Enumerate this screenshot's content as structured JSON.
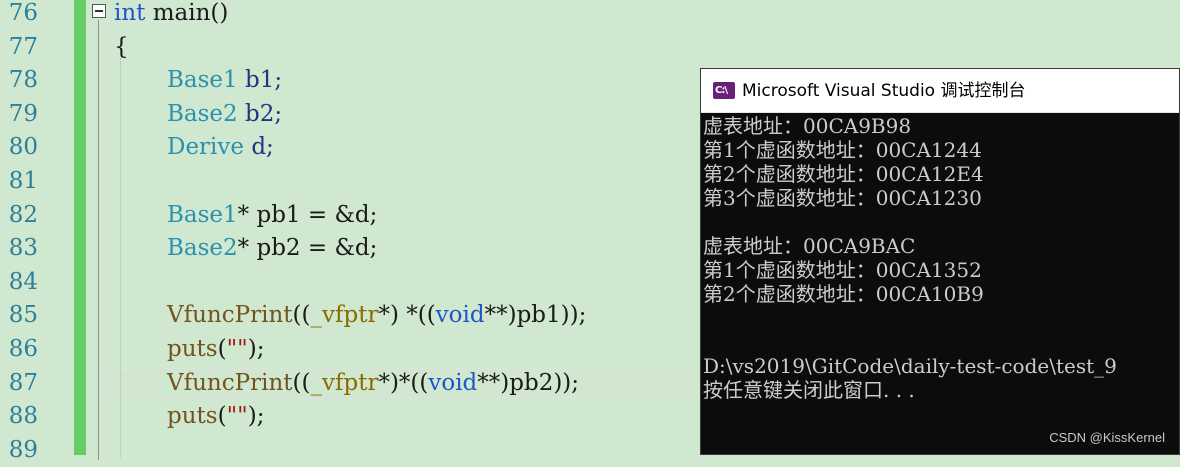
{
  "editor": {
    "line_numbers": [
      "76",
      "77",
      "78",
      "79",
      "80",
      "81",
      "82",
      "83",
      "84",
      "85",
      "86",
      "87",
      "88",
      "89"
    ],
    "code": {
      "l76": {
        "kw": "int",
        "rest": " main()"
      },
      "l77": {
        "text": "{"
      },
      "l78": {
        "type": "Base1",
        "rest": " b1;"
      },
      "l79": {
        "type": "Base2",
        "rest": " b2;"
      },
      "l80": {
        "type": "Derive",
        "rest": " d;"
      },
      "l82": {
        "type": "Base1",
        "rest": "* pb1 = &d;"
      },
      "l83": {
        "type": "Base2",
        "rest": "* pb2 = &d;"
      },
      "l85": {
        "fn": "VfuncPrint",
        "p1": "((",
        "t": "_vfptr",
        "p2": "*) *((",
        "kw": "void",
        "p3": "**)pb1));"
      },
      "l86": {
        "fn": "puts",
        "p1": "(",
        "s": "\"\"",
        "p2": ");"
      },
      "l87": {
        "fn": "VfuncPrint",
        "p1": "((",
        "t": "_vfptr",
        "p2": "*)*((",
        "kw": "void",
        "p3": "**)pb2));"
      },
      "l88": {
        "fn": "puts",
        "p1": "(",
        "s": "\"\"",
        "p2": ");"
      }
    }
  },
  "console": {
    "title": "Microsoft Visual Studio 调试控制台",
    "icon": "visual-studio-console-icon",
    "icon_label": "C:\\",
    "lines": [
      "虚表地址：00CA9B98",
      "第1个虚函数地址：00CA1244",
      "第2个虚函数地址：00CA12E4",
      "第3个虚函数地址：00CA1230",
      "",
      "虚表地址：00CA9BAC",
      "第1个虚函数地址：00CA1352",
      "第2个虚函数地址：00CA10B9",
      "",
      "",
      "D:\\vs2019\\GitCode\\daily-test-code\\test_9",
      "按任意键关闭此窗口. . ."
    ]
  },
  "watermark": "CSDN @KissKernel",
  "colors": {
    "editor_bg": "#cfe8cf",
    "keyword": "#2255cc",
    "type": "#2b91af",
    "console_bg": "#0c0c0c",
    "console_text": "#cccccc",
    "change_bar": "#66cc66"
  }
}
